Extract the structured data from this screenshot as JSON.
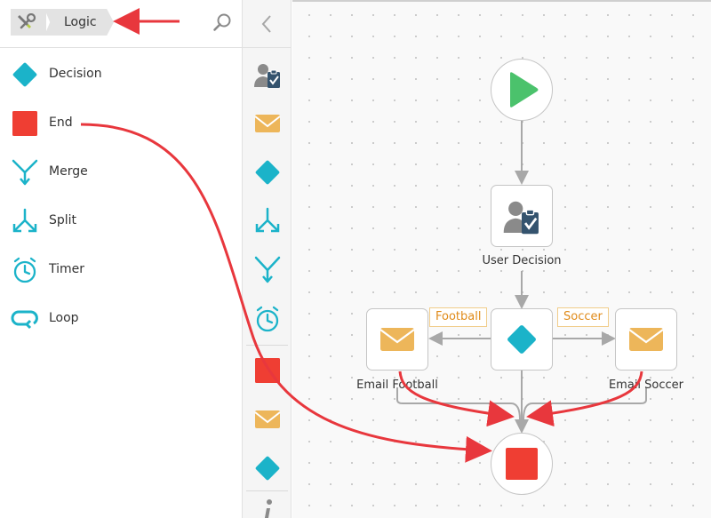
{
  "breadcrumb": {
    "current": "Logic"
  },
  "tools": [
    {
      "label": "Decision",
      "icon": "diamond-icon"
    },
    {
      "label": "End",
      "icon": "red-square-icon"
    },
    {
      "label": "Merge",
      "icon": "merge-icon"
    },
    {
      "label": "Split",
      "icon": "split-icon"
    },
    {
      "label": "Timer",
      "icon": "stopwatch-icon"
    },
    {
      "label": "Loop",
      "icon": "loop-icon"
    }
  ],
  "palette": [
    "user-task-icon",
    "email-icon",
    "diamond-icon",
    "split-icon",
    "merge-icon",
    "stopwatch-icon",
    "red-square-icon",
    "email-icon",
    "diamond-icon",
    "info-icon"
  ],
  "flow": {
    "user_decision": "User Decision",
    "email_football": "Email Football",
    "email_soccer": "Email Soccer",
    "edge_football": "Football",
    "edge_soccer": "Soccer"
  },
  "colors": {
    "accent": "#1bb3c9",
    "end": "#ef3e33",
    "start": "#4bc26c",
    "email": "#edb65a",
    "annotation": "#e8373d",
    "user_task": "#34536e"
  }
}
